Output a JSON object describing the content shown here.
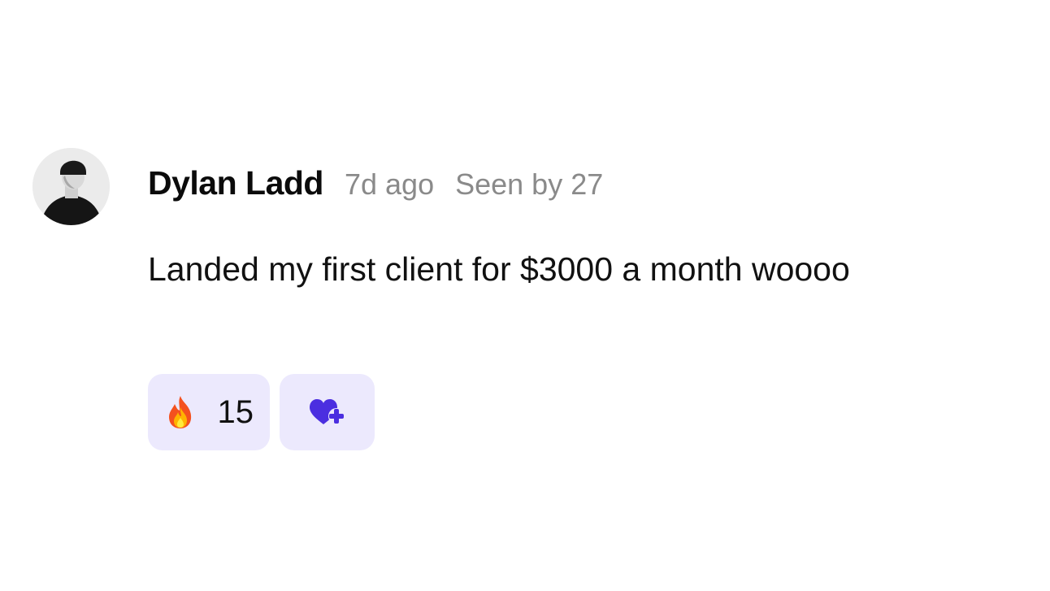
{
  "post": {
    "author": "Dylan Ladd",
    "time_ago": "7d ago",
    "seen_by": "Seen by 27",
    "text": "Landed my first client for $3000 a month woooo",
    "avatar_icon": "user-avatar",
    "reactions": [
      {
        "icon": "fire-emoji-icon",
        "count": "15"
      }
    ],
    "add_reaction_icon": "heart-plus-icon"
  },
  "colors": {
    "reaction_bg": "#ece9fd",
    "accent": "#4b2ee0",
    "meta_text": "#8a8a8a"
  }
}
